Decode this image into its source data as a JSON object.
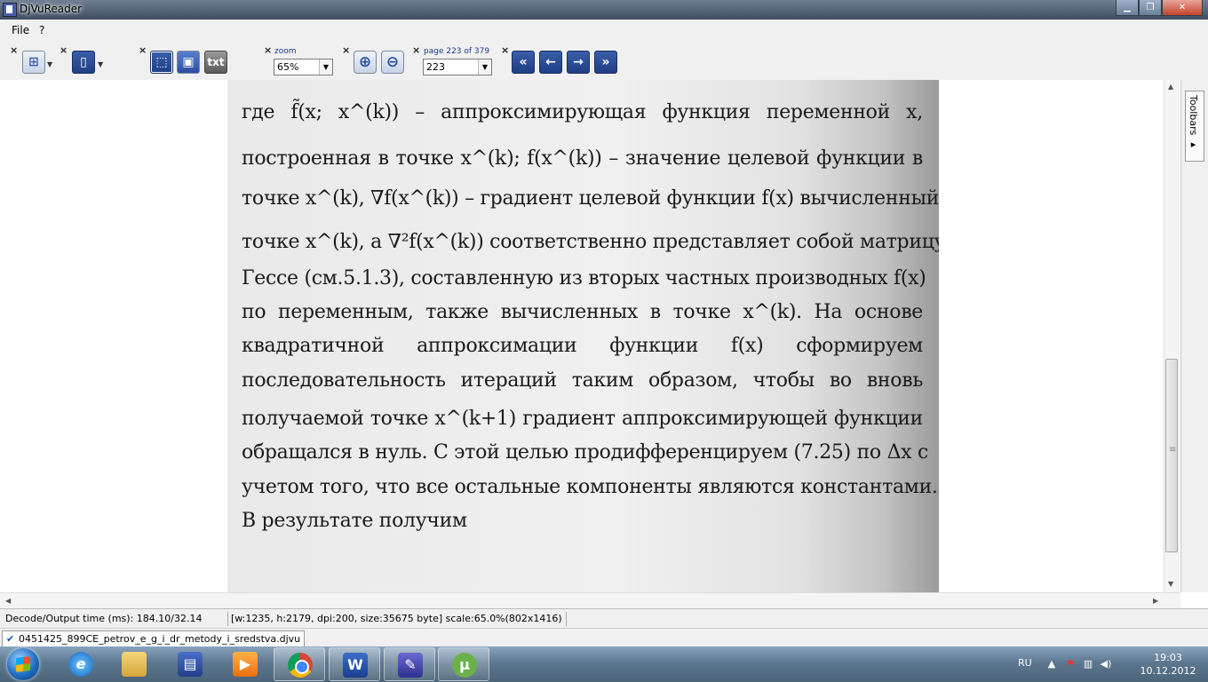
{
  "window": {
    "title": "DjVuReader"
  },
  "menubar": {
    "items": [
      "File",
      "?"
    ]
  },
  "toolbar": {
    "zoom_label": "zoom",
    "zoom_value": "65%",
    "page_label": "page 223 of 379",
    "page_value": "223",
    "txt_label": "txt"
  },
  "document": {
    "lines": [
      "где   f̃(x; x^(k)) –  аппроксимирующая  функция  переменной  x,",
      "построенная в точке  x^(k);   f(x^(k)) –  значение  целевой  функции  в",
      "точке x^(k), ∇f(x^(k))  – градиент целевой функции f(x) вычисленный в",
      "точке x^(k),   а ∇²f(x^(k)) соответственно представляет собой матрицу",
      "Гессе (см.5.1.3), составленную из вторых частных производных f(x)",
      "по  переменным,  также  вычисленных  в  точке  x^(k).  На  основе",
      "квадратичной  аппроксимации  функции  f(x)  сформируем",
      "последовательность  итераций  таким  образом,  чтобы  во  вновь",
      "получаемой  точке  x^(k+1)  градиент  аппроксимирующей  функции",
      "обращался в нуль. С этой целью продифференцируем (7.25) по  Δx с",
      "учетом того, что все остальные компоненты являются константами.",
      "В результате получим"
    ]
  },
  "sidebar": {
    "toolbars_label": "Toolbars ▸"
  },
  "status": {
    "decode": "Decode/Output time (ms): 184.10/32.14",
    "info": "[w:1235, h:2179, dpi:200, size:35675 byte] scale:65.0%(802x1416)"
  },
  "filetab": {
    "name": "0451425_899CE_petrov_e_g_i_dr_metody_i_sredstva.djvu"
  },
  "taskbar": {
    "lang": "RU",
    "time": "19:03",
    "date": "10.12.2012",
    "apps": [
      "internet-explorer",
      "file-explorer",
      "save",
      "media-player",
      "chrome",
      "word",
      "djvu-reader",
      "utorrent"
    ]
  },
  "colors": {
    "toolbar_accent": "#1b3a8f",
    "taskbar": "#5d7790"
  }
}
